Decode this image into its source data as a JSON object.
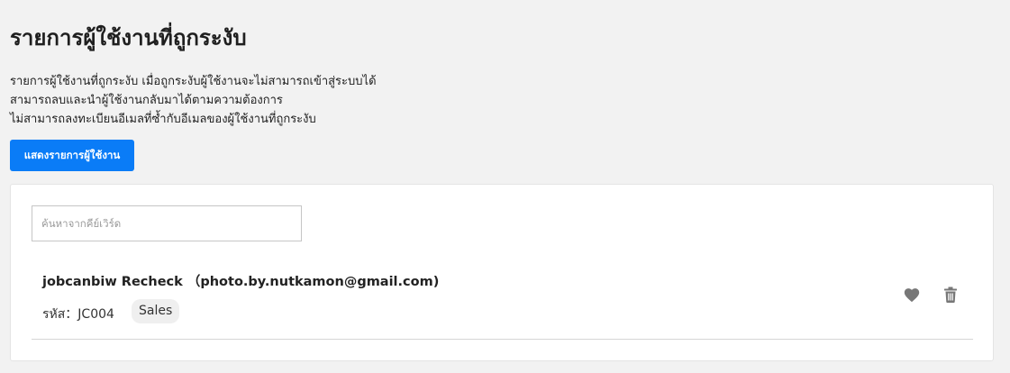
{
  "page": {
    "title": "รายการผู้ใช้งานที่ถูกระงับ",
    "description_lines": [
      "รายการผู้ใช้งานที่ถูกระงับ เมื่อถูกระงับผู้ใช้งานจะไม่สามารถเข้าสู่ระบบได้",
      "สามารถลบและนำผู้ใช้งานกลับมาได้ตามความต้องการ",
      "ไม่สามารถลงทะเบียนอีเมลที่ซ้ำกับอีเมลของผู้ใช้งานที่ถูกระงับ"
    ],
    "show_button_label": "แสดงรายการผู้ใช้งาน"
  },
  "search": {
    "placeholder": "ค้นหาจากคีย์เวิร์ด",
    "value": ""
  },
  "users": [
    {
      "display": "jobcanbiw Recheck （photo.by.nutkamon@gmail.com)",
      "code_label": "รหัส：JC004",
      "department": "Sales",
      "actions": [
        "heart-icon",
        "trash-icon"
      ]
    }
  ],
  "colors": {
    "primary": "#0a7cf7",
    "background": "#f2f2f2",
    "icon": "#777777"
  }
}
